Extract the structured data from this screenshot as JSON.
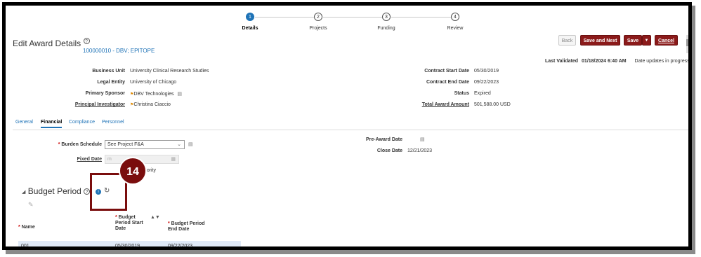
{
  "train": {
    "steps": [
      {
        "number": "1",
        "label": "Details",
        "active": true
      },
      {
        "number": "2",
        "label": "Projects",
        "active": false
      },
      {
        "number": "3",
        "label": "Funding",
        "active": false
      },
      {
        "number": "4",
        "label": "Review",
        "active": false
      }
    ]
  },
  "header": {
    "title": "Edit Award Details",
    "award_id": "100000010 - DBV; EPITOPE",
    "back_label": "Back",
    "save_next_label": "Save and Next",
    "save_label": "Save",
    "save_menu_glyph": "▼",
    "cancel_label": "Cancel",
    "last_validated_label": "Last Validated",
    "last_validated_value": "01/18/2024 6:40 AM",
    "date_status": "Date updates in progress"
  },
  "summary": {
    "left": [
      {
        "label": "Business Unit",
        "value": "University Clinical Research Studies"
      },
      {
        "label": "Legal Entity",
        "value": "University of Chicago"
      },
      {
        "label": "Primary Sponsor",
        "value": "DBV Technologies"
      },
      {
        "label": "Principal Investigator",
        "value": "Christina Ciaccio"
      }
    ],
    "right": [
      {
        "label": "Contract Start Date",
        "value": "05/30/2019"
      },
      {
        "label": "Contract End Date",
        "value": "09/22/2023"
      },
      {
        "label": "Status",
        "value": "Expired"
      },
      {
        "label": "Total Award Amount",
        "value": "501,588.00 USD"
      }
    ]
  },
  "tabs": [
    "General",
    "Financial",
    "Compliance",
    "Personnel"
  ],
  "financial": {
    "burden_schedule_label": "Burden Schedule",
    "burden_schedule_value": "See Project F&A",
    "fixed_date_label": "Fixed Date",
    "fixed_date_placeholder": "m",
    "authority_text": "thority",
    "pre_award_label": "Pre-Award Date",
    "close_date_label": "Close Date",
    "close_date_value": "12/21/2023"
  },
  "budget_period": {
    "title": "Budget Period",
    "step_badge": "14",
    "columns": {
      "name": "Name",
      "start": "Budget Period Start Date",
      "end": "Budget Period End Date"
    },
    "rows": [
      {
        "name": "001",
        "start": "05/30/2019",
        "end": "09/22/2023"
      }
    ]
  },
  "colors": {
    "accent": "#1f73b7",
    "brand": "#8b1a1a"
  }
}
